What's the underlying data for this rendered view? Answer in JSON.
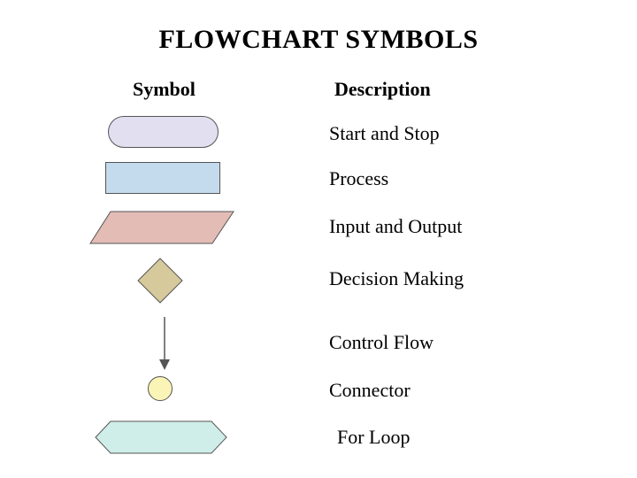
{
  "title": "FLOWCHART SYMBOLS",
  "headers": {
    "symbol": "Symbol",
    "description": "Description"
  },
  "rows": [
    {
      "shape": "terminator",
      "description": "Start and Stop"
    },
    {
      "shape": "process",
      "description": "Process"
    },
    {
      "shape": "parallelogram",
      "description": "Input and Output"
    },
    {
      "shape": "diamond",
      "description": "Decision Making"
    },
    {
      "shape": "arrow",
      "description": "Control Flow"
    },
    {
      "shape": "circle",
      "description": "Connector"
    },
    {
      "shape": "hexagon",
      "description": "For Loop"
    }
  ],
  "colors": {
    "terminator_fill": "#e2dff0",
    "process_fill": "#c4dbee",
    "io_fill": "#e3bcb6",
    "diamond_fill": "#d6c99c",
    "connector_fill": "#faf4b6",
    "hex_fill": "#cfede9",
    "stroke": "#555555"
  }
}
